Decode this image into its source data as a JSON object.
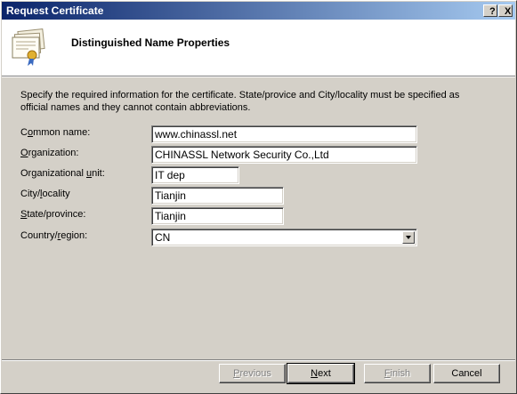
{
  "window": {
    "title": "Request Certificate",
    "help_glyph": "?",
    "close_glyph": "X"
  },
  "header": {
    "heading": "Distinguished Name Properties",
    "icon": "certificate-icon"
  },
  "description": "Specify the required information for the certificate. State/provice and City/locality must be specified as official names and they cannot contain abbreviations.",
  "form": {
    "common_name": {
      "label_pre": "C",
      "label_key": "o",
      "label_post": "mmon name:",
      "value": "www.chinassl.net"
    },
    "organization": {
      "label_pre": "",
      "label_key": "O",
      "label_post": "rganization:",
      "value": "CHINASSL Network Security Co.,Ltd"
    },
    "org_unit": {
      "label_pre": "Organizational ",
      "label_key": "u",
      "label_post": "nit:",
      "value": "IT dep"
    },
    "city": {
      "label_pre": "City/",
      "label_key": "l",
      "label_post": "ocality",
      "value": "Tianjin"
    },
    "state": {
      "label_pre": "",
      "label_key": "S",
      "label_post": "tate/province:",
      "value": "Tianjin"
    },
    "country": {
      "label_pre": "Country/",
      "label_key": "r",
      "label_post": "egion:",
      "value": "CN"
    }
  },
  "buttons": {
    "previous": {
      "pre": "",
      "key": "P",
      "post": "revious"
    },
    "next": {
      "pre": "",
      "key": "N",
      "post": "ext"
    },
    "finish": {
      "pre": "",
      "key": "F",
      "post": "inish"
    },
    "cancel": "Cancel"
  },
  "colors": {
    "titlebar_start": "#0a246a",
    "titlebar_end": "#a6caf0",
    "dialog_face": "#d4d0c8"
  }
}
